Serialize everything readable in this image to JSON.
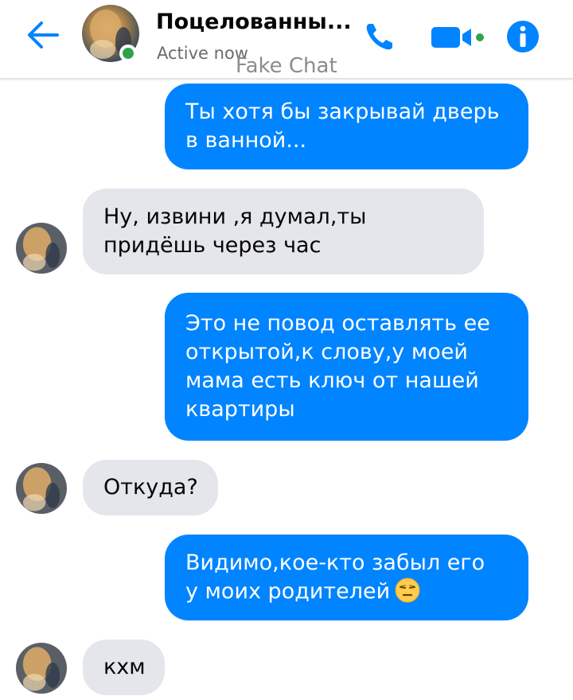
{
  "header": {
    "contact_name": "Поцелованны...",
    "status": "Active now",
    "watermark": "Fake Chat"
  },
  "colors": {
    "accent": "#0084ff",
    "incoming_bubble": "#e4e6eb",
    "online": "#31a24c"
  },
  "icons": [
    "back-arrow-icon",
    "phone-icon",
    "video-camera-icon",
    "info-icon",
    "online-indicator",
    "expressionless-face-emoji"
  ],
  "messages": [
    {
      "direction": "out",
      "lines": [
        "Ты хотя бы закрывай дверь",
        "в ванной..."
      ]
    },
    {
      "direction": "in",
      "lines": [
        "Ну, извини ,я думал,ты",
        "придёшь через час"
      ]
    },
    {
      "direction": "out",
      "lines": [
        "Это не повод оставлять ее",
        "открытой,к слову,у моей",
        "мама есть ключ от нашей",
        "квартиры"
      ]
    },
    {
      "direction": "in",
      "lines": [
        "Откуда?"
      ]
    },
    {
      "direction": "out",
      "lines": [
        "Видимо,кое-кто забыл его",
        "у моих родителей"
      ],
      "emoji": "😑"
    },
    {
      "direction": "in",
      "lines": [
        "кхм"
      ]
    }
  ]
}
